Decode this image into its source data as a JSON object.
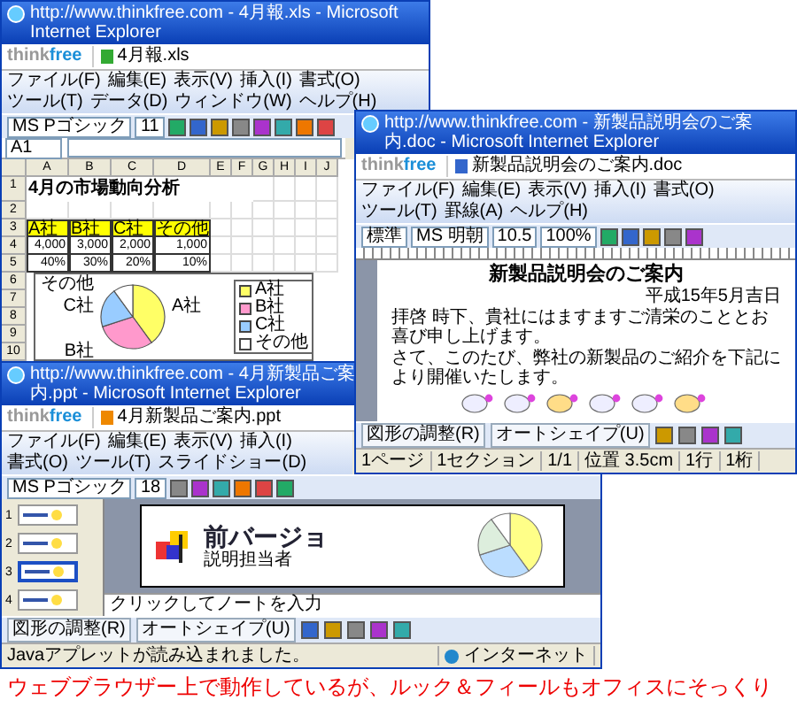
{
  "spreadsheet": {
    "title": "http://www.thinkfree.com - 4月報.xls - Microsoft Internet Explorer",
    "logo": {
      "part_1": "think",
      "part_2": "free"
    },
    "file_name": "4月報.xls",
    "menu": [
      "ファイル(F)",
      "編集(E)",
      "表示(V)",
      "挿入(I)",
      "書式(O)",
      "ツール(T)",
      "データ(D)",
      "ウィンドウ(W)",
      "ヘルプ(H)"
    ],
    "font_name": "MS Pゴシック",
    "font_size": "11",
    "cell_ref": "A1",
    "columns": [
      "A",
      "B",
      "C",
      "D",
      "E",
      "F",
      "G",
      "H",
      "I",
      "J"
    ],
    "row_numbers": [
      "1",
      "2",
      "3",
      "4",
      "5",
      "6",
      "7",
      "8",
      "9",
      "10"
    ],
    "sheet_title": "4月の市場動向分析",
    "headers": [
      "A社",
      "B社",
      "C社",
      "その他"
    ],
    "amounts": [
      "4,000",
      "3,000",
      "2,000",
      "1,000"
    ],
    "shares": [
      "40%",
      "30%",
      "20%",
      "10%"
    ],
    "chart": {
      "chart_data": {
        "type": "pie",
        "categories": [
          "A社",
          "B社",
          "C社",
          "その他"
        ],
        "values": [
          40,
          30,
          20,
          10
        ]
      },
      "legend": [
        {
          "label": "A社",
          "color": "#ffff66"
        },
        {
          "label": "B社",
          "color": "#ff99cc"
        },
        {
          "label": "C社",
          "color": "#99ccff"
        },
        {
          "label": "その他",
          "color": "#ffffff"
        }
      ]
    }
  },
  "document": {
    "title": "http://www.thinkfree.com - 新製品説明会のご案内.doc - Microsoft Internet Explorer",
    "logo": {
      "part_1": "think",
      "part_2": "free"
    },
    "file_name": "新製品説明会のご案内.doc",
    "menu": [
      "ファイル(F)",
      "編集(E)",
      "表示(V)",
      "挿入(I)",
      "書式(O)",
      "ツール(T)",
      "罫線(A)",
      "ヘルプ(H)"
    ],
    "style": "標準",
    "font_name": "MS 明朝",
    "font_size": "10.5",
    "zoom": "100%",
    "heading": "新製品説明会のご案内",
    "date": "平成15年5月吉日",
    "paragraphs": [
      "拝啓 時下、貴社にはますますご清栄のこととお喜び申し上げます。",
      "さて、このたび、弊社の新製品のご紹介を下記により開催いたします。"
    ],
    "draw_menu": [
      "図形の調整(R)",
      "オートシェイプ(U)"
    ],
    "status": [
      "1ページ",
      "1セクション",
      "1/1",
      "位置 3.5cm",
      "1行",
      "1桁"
    ]
  },
  "presentation": {
    "title": "http://www.thinkfree.com - 4月新製品ご案内.ppt - Microsoft Internet Explorer",
    "logo": {
      "part_1": "think",
      "part_2": "free"
    },
    "file_name": "4月新製品ご案内.ppt",
    "menu": [
      "ファイル(F)",
      "編集(E)",
      "表示(V)",
      "挿入(I)",
      "書式(O)",
      "ツール(T)",
      "スライドショー(D)"
    ],
    "font_name": "MS Pゴシック",
    "font_size": "18",
    "thumbnails": [
      {
        "number": "1",
        "selected": false
      },
      {
        "number": "2",
        "selected": false
      },
      {
        "number": "3",
        "selected": true
      },
      {
        "number": "4",
        "selected": false
      }
    ],
    "slide_title": "前バージョ",
    "slide_subtitle": "説明担当者",
    "notes_placeholder": "クリックしてノートを入力",
    "draw_menu": [
      "図形の調整(R)",
      "オートシェイプ(U)"
    ],
    "status": "Javaアプレットが読み込まれました。",
    "zone": "インターネット"
  },
  "caption": "ウェブブラウザー上で動作しているが、ルック＆フィールもオフィスにそっくり"
}
